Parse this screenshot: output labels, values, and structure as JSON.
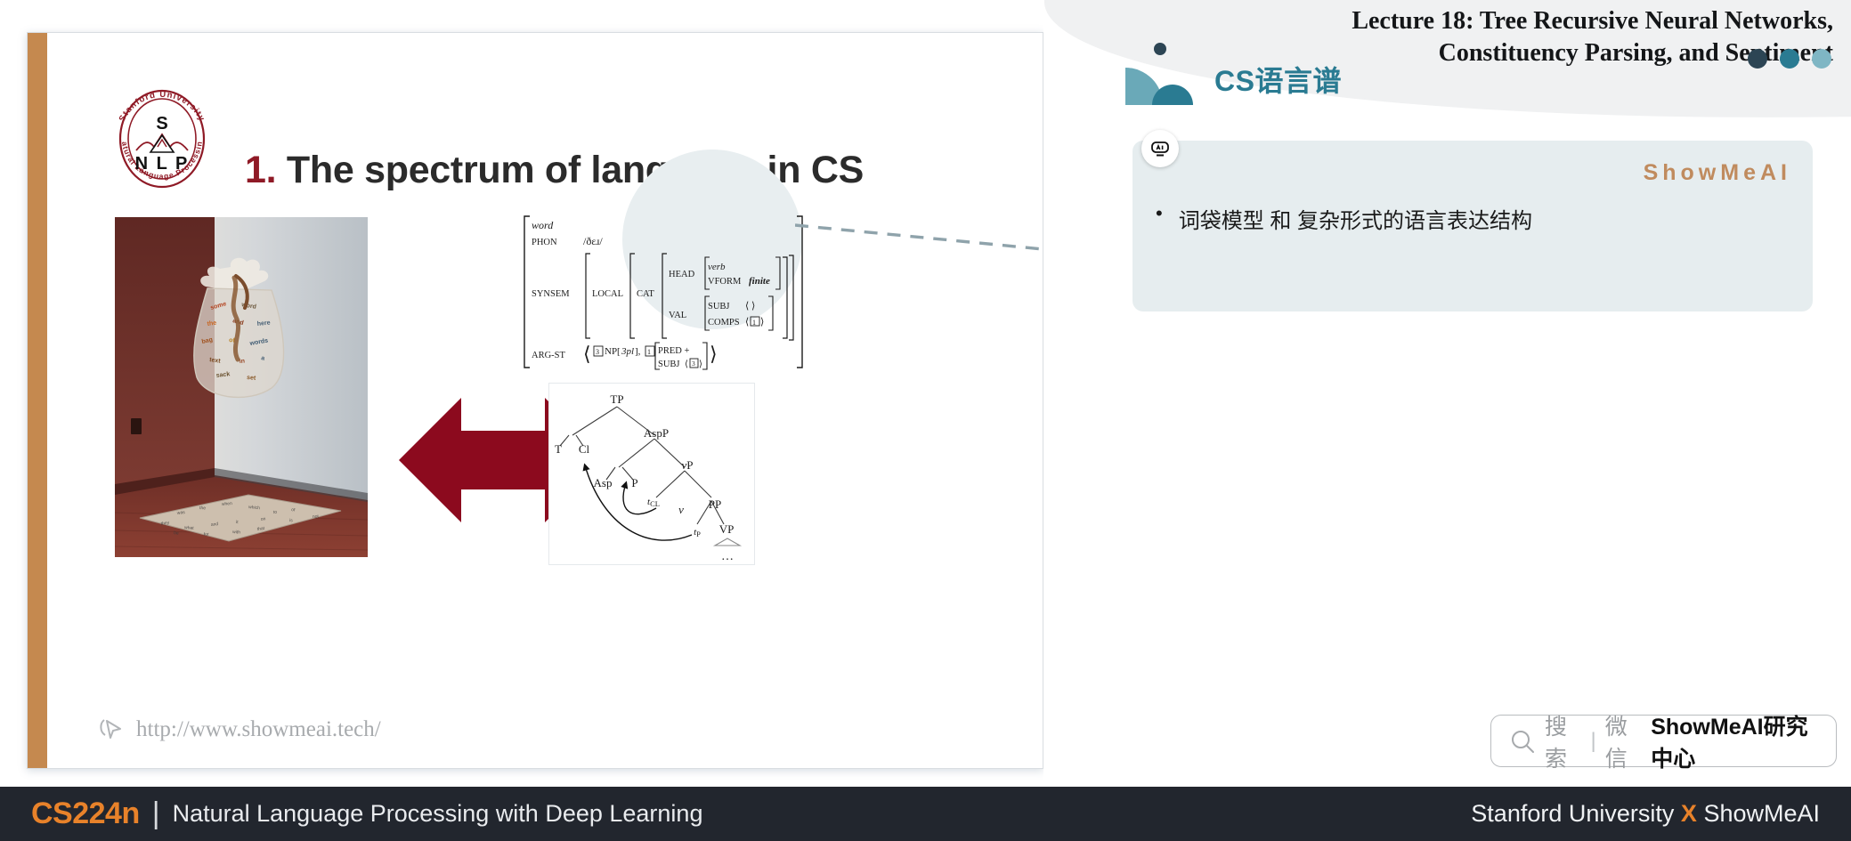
{
  "header": {
    "lecture_title_line1": "Lecture 18: Tree Recursive Neural Networks,",
    "lecture_title_line2": "Constituency Parsing, and Sentiment",
    "section_title": "CS语言谱",
    "dot_colors": [
      "#2c4554",
      "#2a7b92",
      "#7fb6c4"
    ],
    "accent_teal": "#6aa9b8",
    "accent_teal_dark": "#2a7b92"
  },
  "content_card": {
    "ai_icon": "ai-robot-icon",
    "brand": "ShowMeAI",
    "brand_color": "#c08b5e",
    "bullet_symbol": "•",
    "bullet_text": "词袋模型 和 复杂形式的语言表达结构"
  },
  "search": {
    "icon": "search-icon",
    "placeholder": "搜索",
    "divider": "|",
    "channel": "微信",
    "account": "ShowMeAI研究中心"
  },
  "slide": {
    "accent_bar_color": "#c5894f",
    "logo": {
      "name": "stanford-nlp-logo",
      "top_text": "Stanford University",
      "bottom_text": "Natural Language Processing",
      "letters_top": "S",
      "letters_bottom": "N L P",
      "color": "#8f1a26"
    },
    "title_number": "1.",
    "title_text": "The spectrum of language in CS",
    "title_number_color": "#8f1a26",
    "arrow": {
      "name": "double-headed-arrow",
      "color": "#8c0a1e",
      "direction": "left-right"
    },
    "photo": {
      "name": "bag-of-words-photo",
      "description": "Plastic bag of words hanging in a room corner with words scattered on a mat"
    },
    "avm": {
      "title": "HPSG attribute value matrix",
      "rows": [
        {
          "label": "word",
          "italic": true
        },
        {
          "label": "PHON",
          "value": "/ðɛɹ/"
        },
        {
          "label": "SYNSEM",
          "value": "LOCAL"
        },
        {
          "label": "LOCAL",
          "value": "CAT"
        },
        {
          "label": "HEAD",
          "value": "verb"
        },
        {
          "label": "VFORM",
          "value": "finite"
        },
        {
          "label": "VAL",
          "value": ""
        },
        {
          "label": "SUBJ",
          "value": "⟨ ⟩"
        },
        {
          "label": "COMPS",
          "value": "⟨1⟩"
        },
        {
          "label": "ARG-ST",
          "value": "⟨3NP[3pl], 1 [PRED + / SUBJ ⟨3⟩]⟩"
        }
      ],
      "labels": [
        "word",
        "PHON",
        "SYNSEM",
        "LOCAL",
        "CAT",
        "HEAD",
        "VFORM",
        "VAL",
        "SUBJ",
        "COMPS",
        "ARG-ST",
        "PRED",
        "SUBJ"
      ],
      "values": [
        "/ðɛɹ/",
        "verb",
        "finite",
        "⟨ ⟩",
        "⟨1⟩",
        "+",
        "⟨3⟩"
      ],
      "arg_st": "3NP[3pl], 1",
      "pred_val": "PRED  +",
      "subj_val": "SUBJ  ⟨3⟩"
    },
    "tree": {
      "name": "syntax-tree",
      "nodes": [
        "TP",
        "T",
        "Cl",
        "AspP",
        "Asp",
        "P",
        "vP",
        "tCL",
        "v",
        "PP",
        "tP",
        "VP",
        "…"
      ],
      "movement_arrows": 2
    },
    "watermark": {
      "icon": "cursor-click-icon",
      "url": "http://www.showmeai.tech/"
    },
    "highlight_circle_color": "#e8eef0",
    "connector_color": "#8fa3ab"
  },
  "footer": {
    "course_code": "CS224n",
    "divider": "|",
    "course_name": "Natural Language Processing with Deep Learning",
    "right_left": "Stanford University",
    "right_x": "X",
    "right_right": "ShowMeAI",
    "bg": "#22262e",
    "accent": "#e8822a"
  }
}
